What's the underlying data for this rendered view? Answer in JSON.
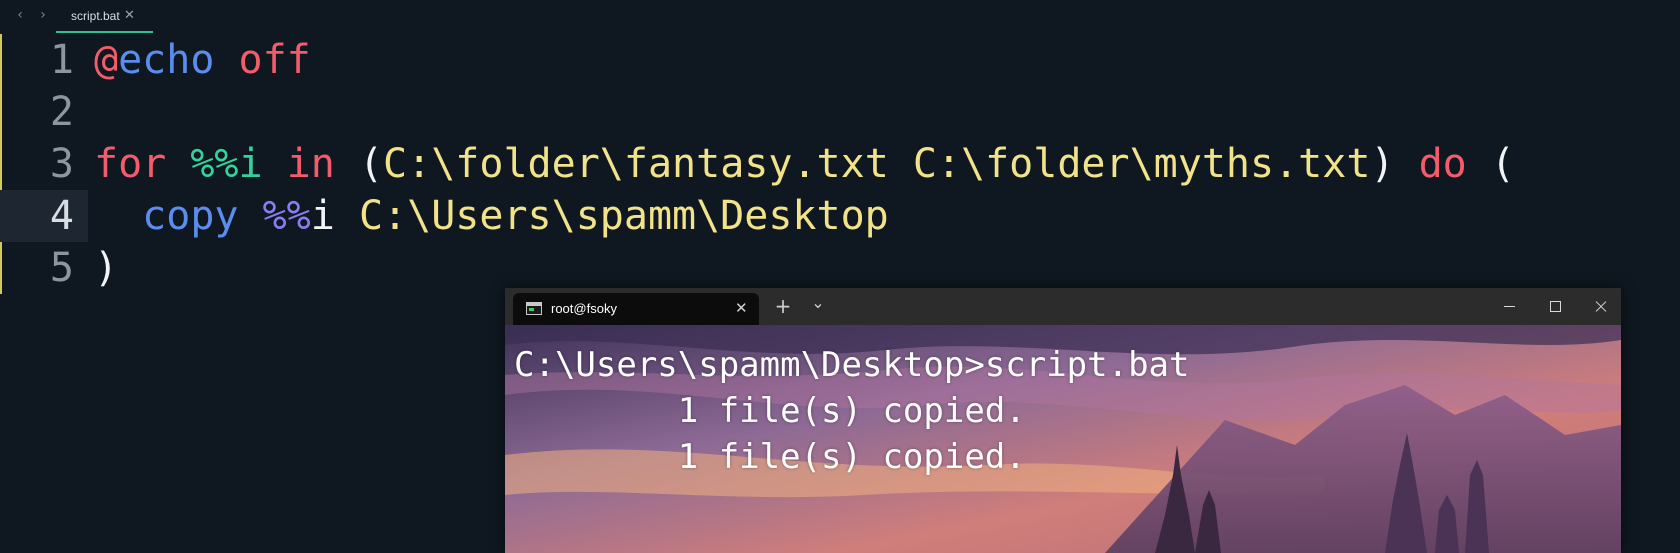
{
  "editor": {
    "nav": {
      "back_icon": "‹",
      "forward_icon": "›"
    },
    "tab": {
      "label": "script.bat",
      "close_icon": "✕"
    },
    "lines": [
      {
        "number": "1",
        "tokens": [
          {
            "text": "@",
            "cls": "t-at"
          },
          {
            "text": "echo",
            "cls": "t-blue"
          },
          {
            "text": " ",
            "cls": "t-white"
          },
          {
            "text": "off",
            "cls": "t-red"
          }
        ]
      },
      {
        "number": "2",
        "tokens": []
      },
      {
        "number": "3",
        "tokens": [
          {
            "text": "for",
            "cls": "t-red"
          },
          {
            "text": " ",
            "cls": "t-white"
          },
          {
            "text": "%%i",
            "cls": "t-green"
          },
          {
            "text": " ",
            "cls": "t-white"
          },
          {
            "text": "in",
            "cls": "t-red"
          },
          {
            "text": " ",
            "cls": "t-white"
          },
          {
            "text": "(",
            "cls": "t-white"
          },
          {
            "text": "C:\\folder\\fantasy.txt C:\\folder\\myths.txt",
            "cls": "t-yel"
          },
          {
            "text": ") ",
            "cls": "t-white"
          },
          {
            "text": "do",
            "cls": "t-red"
          },
          {
            "text": " (",
            "cls": "t-white"
          }
        ]
      },
      {
        "number": "4",
        "active": true,
        "tokens": [
          {
            "text": "  ",
            "cls": "t-white"
          },
          {
            "text": "copy",
            "cls": "t-blue"
          },
          {
            "text": " ",
            "cls": "t-white"
          },
          {
            "text": "%%",
            "cls": "t-purp"
          },
          {
            "text": "i",
            "cls": "t-white"
          },
          {
            "text": " ",
            "cls": "t-white"
          },
          {
            "text": "C:\\Users\\spamm\\Desktop",
            "cls": "t-yel"
          }
        ]
      },
      {
        "number": "5",
        "tokens": [
          {
            "text": ")",
            "cls": "t-white"
          }
        ]
      }
    ]
  },
  "terminal": {
    "tab": {
      "label": "root@fsoky",
      "close_icon": "✕"
    },
    "new_tab_icon": "+",
    "dropdown_icon": "⌄",
    "output": [
      "C:\\Users\\spamm\\Desktop>script.bat",
      "        1 file(s) copied.",
      "        1 file(s) copied."
    ]
  }
}
